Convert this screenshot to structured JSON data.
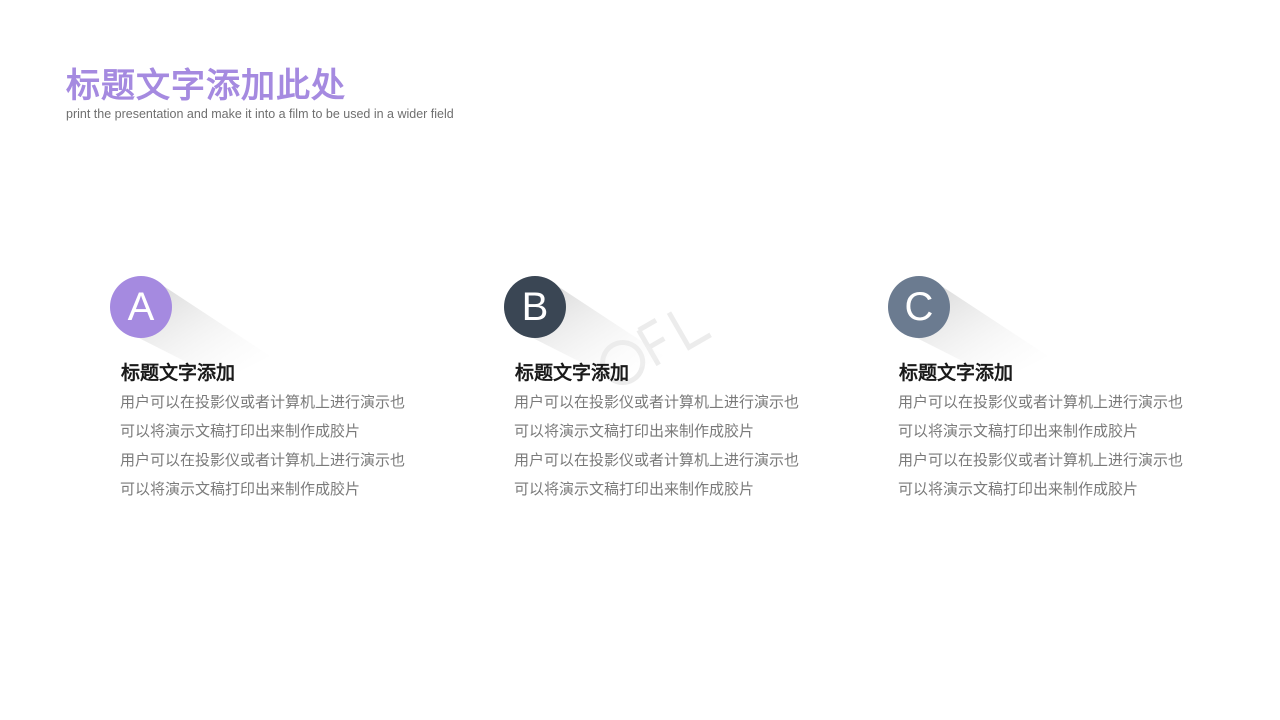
{
  "header": {
    "title": "标题文字添加此处",
    "subtitle": "print the presentation and make it into a film to be used in a wider field"
  },
  "cards": [
    {
      "letter": "A",
      "color": "#a58ae0",
      "heading": "标题文字添加",
      "lines": [
        "用户可以在投影仪或者计算机上进行演示也",
        "可以将演示文稿打印出来制作成胶片",
        "用户可以在投影仪或者计算机上进行演示也",
        "可以将演示文稿打印出来制作成胶片"
      ]
    },
    {
      "letter": "B",
      "color": "#3a4654",
      "heading": "标题文字添加",
      "lines": [
        "用户可以在投影仪或者计算机上进行演示也",
        "可以将演示文稿打印出来制作成胶片",
        "用户可以在投影仪或者计算机上进行演示也",
        "可以将演示文稿打印出来制作成胶片"
      ]
    },
    {
      "letter": "C",
      "color": "#6b7b90",
      "heading": "标题文字添加",
      "lines": [
        "用户可以在投影仪或者计算机上进行演示也",
        "可以将演示文稿打印出来制作成胶片",
        "用户可以在投影仪或者计算机上进行演示也",
        "可以将演示文稿打印出来制作成胶片"
      ]
    }
  ]
}
